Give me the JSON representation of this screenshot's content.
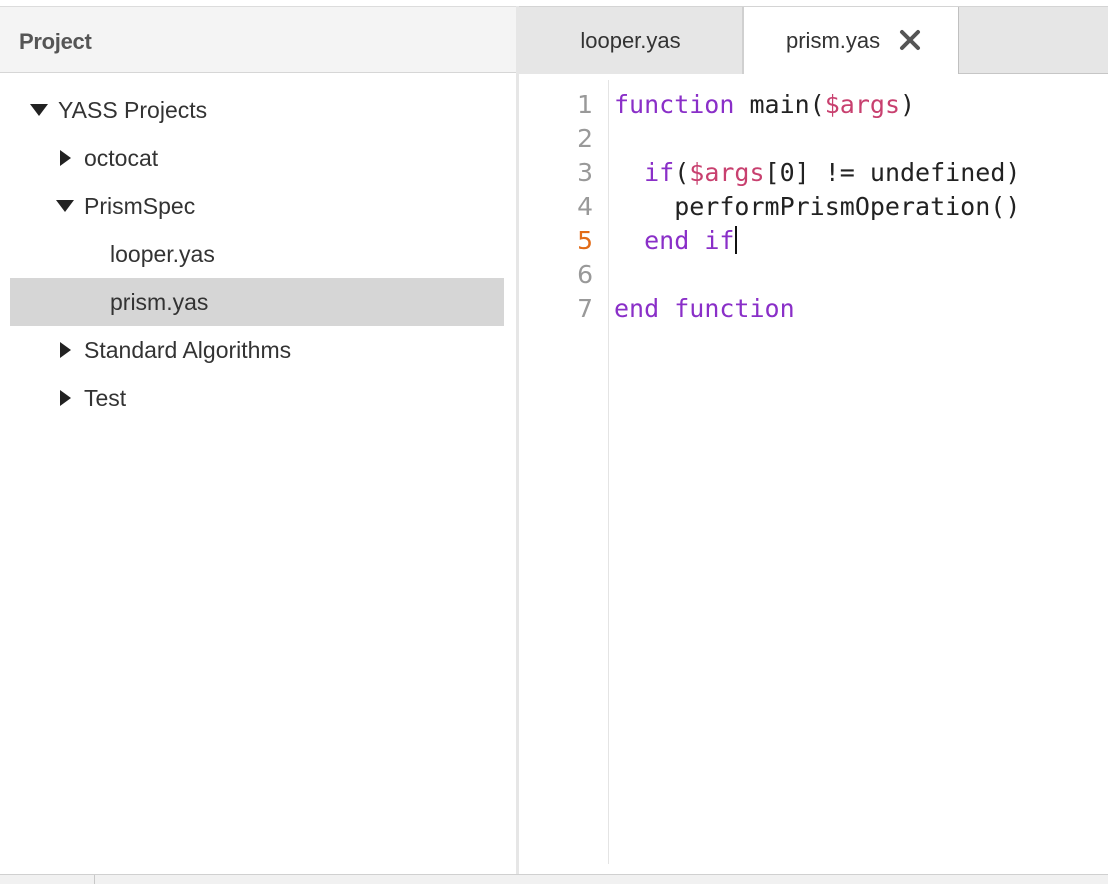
{
  "project_panel": {
    "title": "Project",
    "tree": [
      {
        "label": "YASS Projects",
        "state": "expanded",
        "depth": 0,
        "selected": false
      },
      {
        "label": "octocat",
        "state": "collapsed",
        "depth": 1,
        "selected": false
      },
      {
        "label": "PrismSpec",
        "state": "expanded",
        "depth": 1,
        "selected": false
      },
      {
        "label": "looper.yas",
        "state": "file",
        "depth": 2,
        "selected": false
      },
      {
        "label": "prism.yas",
        "state": "file",
        "depth": 2,
        "selected": true
      },
      {
        "label": "Standard Algorithms",
        "state": "collapsed",
        "depth": 1,
        "selected": false
      },
      {
        "label": "Test",
        "state": "collapsed",
        "depth": 1,
        "selected": false
      }
    ]
  },
  "tabs": [
    {
      "label": "looper.yas",
      "active": false
    },
    {
      "label": "prism.yas",
      "active": true,
      "close_icon": "close-x-icon"
    }
  ],
  "editor": {
    "active_line": "5",
    "lines": [
      {
        "number": "1",
        "text": "function main($args)"
      },
      {
        "number": "2",
        "text": ""
      },
      {
        "number": "3",
        "text": "  if($args[0] != undefined)"
      },
      {
        "number": "4",
        "text": "    performPrismOperation()"
      },
      {
        "number": "5",
        "text": "  end if"
      },
      {
        "number": "6",
        "text": ""
      },
      {
        "number": "7",
        "text": "end function"
      }
    ],
    "colors": {
      "keyword": "#8a2fc8",
      "variable": "#c8406f",
      "active_line_number": "#e26b17"
    }
  }
}
